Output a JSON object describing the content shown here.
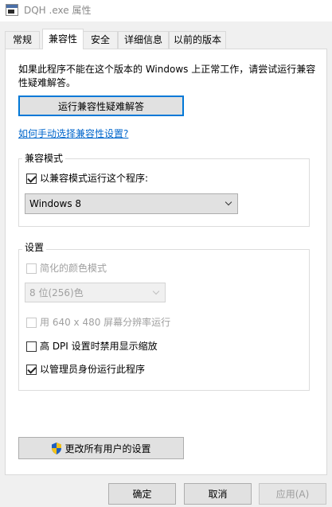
{
  "window": {
    "title": "DQH .exe 属性"
  },
  "tabs": [
    {
      "label": "常规"
    },
    {
      "label": "兼容性"
    },
    {
      "label": "安全"
    },
    {
      "label": "详细信息"
    },
    {
      "label": "以前的版本"
    }
  ],
  "compat": {
    "intro": "如果此程序不能在这个版本的 Windows 上正常工作，请尝试运行兼容性疑难解答。",
    "troubleshoot_button": "运行兼容性疑难解答",
    "manual_link": "如何手动选择兼容性设置?",
    "mode_group": {
      "label": "兼容模式",
      "checkbox_label": "以兼容模式运行这个程序:",
      "checked": true,
      "selected_os": "Windows 8"
    },
    "settings_group": {
      "label": "设置",
      "reduced_color": {
        "label": "简化的颜色模式",
        "checked": false,
        "disabled": true
      },
      "color_select": "8 位(256)色",
      "run_640": {
        "label": "用 640 x 480 屏幕分辨率运行",
        "checked": false,
        "disabled": true
      },
      "high_dpi": {
        "label": "高 DPI 设置时禁用显示缩放",
        "checked": false
      },
      "run_admin": {
        "label": "以管理员身份运行此程序",
        "checked": true
      }
    },
    "all_users_button": "更改所有用户的设置"
  },
  "footer": {
    "ok": "确定",
    "cancel": "取消",
    "apply": "应用(A)"
  },
  "colors": {
    "accent": "#0078d7",
    "link": "#0066cc",
    "shield_blue": "#1f5fbf",
    "shield_yellow": "#f2c21a"
  }
}
